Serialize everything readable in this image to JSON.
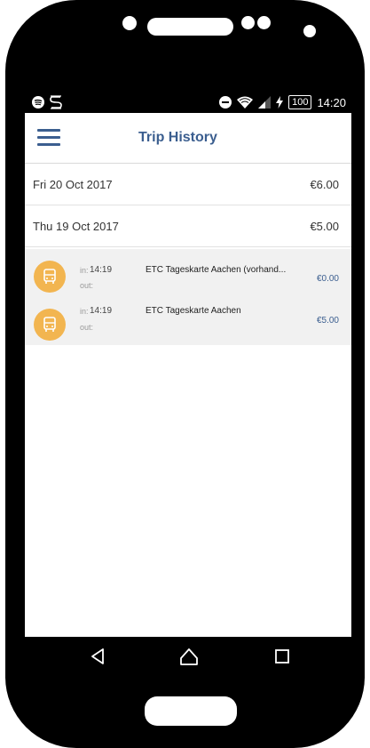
{
  "status_bar": {
    "time": "14:20",
    "battery": "100",
    "icons": [
      "spotify-icon",
      "s-app-icon",
      "dnd-icon",
      "wifi-icon",
      "signal-icon",
      "charging-icon",
      "battery-icon"
    ]
  },
  "app_bar": {
    "title": "Trip History",
    "menu_icon": "hamburger-menu-icon"
  },
  "days": [
    {
      "date": "Fri 20 Oct 2017",
      "amount": "€6.00"
    },
    {
      "date": "Thu 19 Oct 2017",
      "amount": "€5.00"
    }
  ],
  "trips": [
    {
      "in_label": "in:",
      "in_time": "14:19",
      "out_label": "out:",
      "name": "ETC Tageskarte Aachen (vorhand...",
      "price": "€0.00",
      "icon": "bus-icon"
    },
    {
      "in_label": "in:",
      "in_time": "14:19",
      "out_label": "out:",
      "name": "ETC Tageskarte Aachen",
      "price": "€5.00",
      "icon": "bus-icon"
    }
  ],
  "nav_bar": [
    "back-icon",
    "home-icon",
    "recents-icon"
  ],
  "colors": {
    "accent": "#3b5e8f",
    "bus_badge": "#f2b550",
    "trip_bg": "#f1f1f1"
  }
}
